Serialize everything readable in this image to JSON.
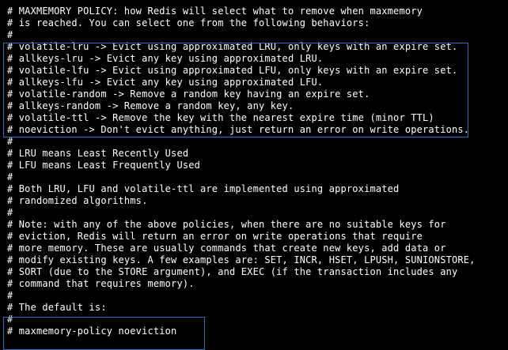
{
  "terminal": {
    "lines": [
      "# MAXMEMORY POLICY: how Redis will select what to remove when maxmemory",
      "# is reached. You can select one from the following behaviors:",
      "#",
      "# volatile-lru -> Evict using approximated LRU, only keys with an expire set.",
      "# allkeys-lru -> Evict any key using approximated LRU.",
      "# volatile-lfu -> Evict using approximated LFU, only keys with an expire set.",
      "# allkeys-lfu -> Evict any key using approximated LFU.",
      "# volatile-random -> Remove a random key having an expire set.",
      "# allkeys-random -> Remove a random key, any key.",
      "# volatile-ttl -> Remove the key with the nearest expire time (minor TTL)",
      "# noeviction -> Don't evict anything, just return an error on write operations.",
      "#",
      "# LRU means Least Recently Used",
      "# LFU means Least Frequently Used",
      "#",
      "# Both LRU, LFU and volatile-ttl are implemented using approximated",
      "# randomized algorithms.",
      "#",
      "# Note: with any of the above policies, when there are no suitable keys for",
      "# eviction, Redis will return an error on write operations that require",
      "# more memory. These are usually commands that create new keys, add data or",
      "# modify existing keys. A few examples are: SET, INCR, HSET, LPUSH, SUNIONSTORE,",
      "# SORT (due to the STORE argument), and EXEC (if the transaction includes any",
      "# command that requires memory).",
      "#",
      "# The default is:",
      "#",
      "# maxmemory-policy noeviction"
    ]
  },
  "colors": {
    "background": "#000000",
    "text": "#ffffff",
    "highlight_border": "#2f6fb3"
  }
}
